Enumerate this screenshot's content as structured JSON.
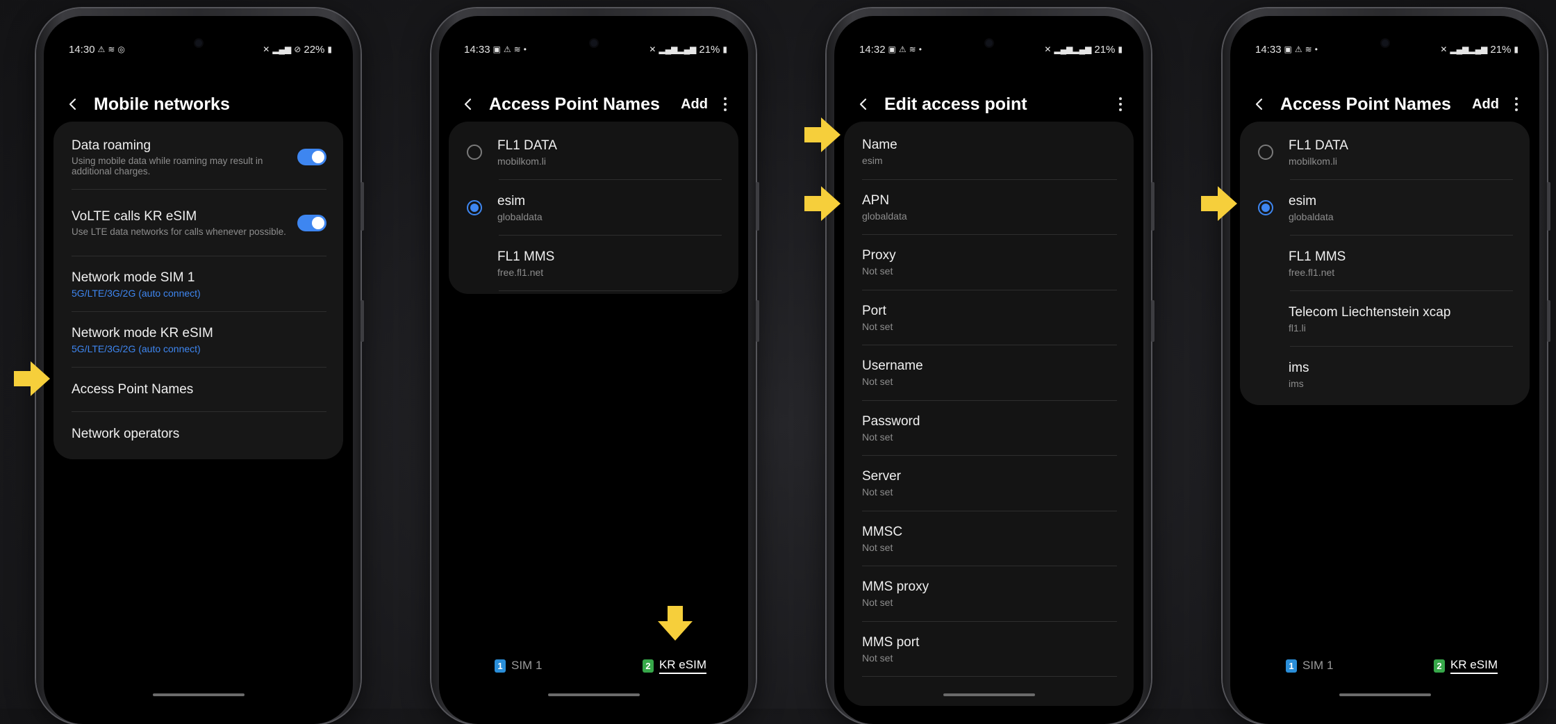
{
  "colors": {
    "accent": "#3e86f0",
    "arrow": "#f6cf3b",
    "sim1": "#2a8ed9",
    "sim2": "#37a84a"
  },
  "screen1": {
    "status": {
      "time": "14:30",
      "battery": "22%"
    },
    "title": "Mobile networks",
    "items": [
      {
        "label": "Data roaming",
        "sub": "Using mobile data while roaming may result in additional charges.",
        "toggle": true
      },
      {
        "label": "VoLTE calls KR eSIM",
        "sub": "Use LTE data networks for calls whenever possible.",
        "toggle": true
      },
      {
        "label": "Network mode SIM 1",
        "sub": "5G/LTE/3G/2G (auto connect)"
      },
      {
        "label": "Network mode KR eSIM",
        "sub": "5G/LTE/3G/2G (auto connect)"
      },
      {
        "label": "Access Point Names"
      },
      {
        "label": "Network operators"
      }
    ]
  },
  "screen2": {
    "status": {
      "time": "14:33",
      "battery": "21%"
    },
    "title": "Access Point Names",
    "add": "Add",
    "items": [
      {
        "name": "FL1 DATA",
        "apn": "mobilkom.li",
        "selected": false
      },
      {
        "name": "esim",
        "apn": "globaldata",
        "selected": true
      },
      {
        "name": "FL1 MMS",
        "apn": "free.fl1.net"
      }
    ],
    "sims": [
      {
        "num": "1",
        "label": "SIM 1"
      },
      {
        "num": "2",
        "label": "KR eSIM",
        "active": true
      }
    ]
  },
  "screen3": {
    "status": {
      "time": "14:32",
      "battery": "21%"
    },
    "title": "Edit access point",
    "items": [
      {
        "label": "Name",
        "value": "esim"
      },
      {
        "label": "APN",
        "value": "globaldata"
      },
      {
        "label": "Proxy",
        "value": "Not set"
      },
      {
        "label": "Port",
        "value": "Not set"
      },
      {
        "label": "Username",
        "value": "Not set"
      },
      {
        "label": "Password",
        "value": "Not set"
      },
      {
        "label": "Server",
        "value": "Not set"
      },
      {
        "label": "MMSC",
        "value": "Not set"
      },
      {
        "label": "MMS proxy",
        "value": "Not set"
      },
      {
        "label": "MMS port",
        "value": "Not set"
      }
    ]
  },
  "screen4": {
    "status": {
      "time": "14:33",
      "battery": "21%"
    },
    "title": "Access Point Names",
    "add": "Add",
    "items": [
      {
        "name": "FL1 DATA",
        "apn": "mobilkom.li",
        "selected": false
      },
      {
        "name": "esim",
        "apn": "globaldata",
        "selected": true
      },
      {
        "name": "FL1 MMS",
        "apn": "free.fl1.net"
      },
      {
        "name": "Telecom Liechtenstein xcap",
        "apn": "fl1.li"
      },
      {
        "name": "ims",
        "apn": "ims"
      }
    ],
    "sims": [
      {
        "num": "1",
        "label": "SIM 1"
      },
      {
        "num": "2",
        "label": "KR eSIM",
        "active": true
      }
    ]
  }
}
